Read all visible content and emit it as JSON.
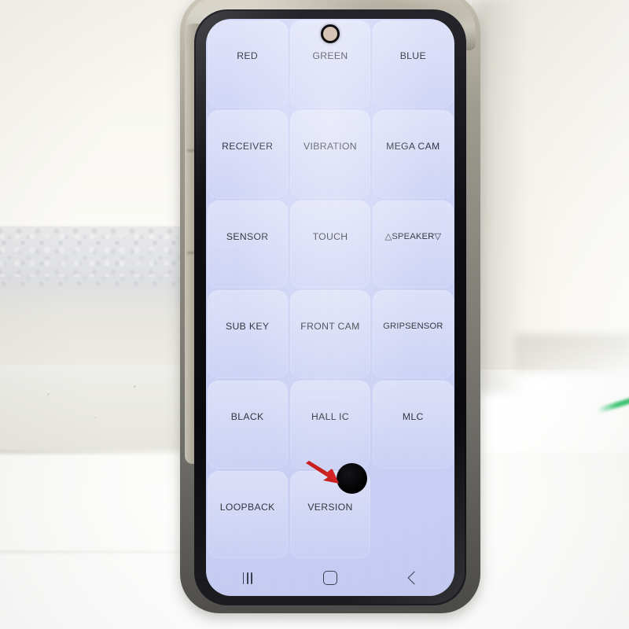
{
  "scene": {
    "description": "Smartphone LCD test mode grid displayed on a worn Samsung-style phone held on white styrofoam",
    "background_objects": [
      "styrofoam-block",
      "white-table",
      "green-streak"
    ]
  },
  "phone": {
    "frame_color": "#8e8b82",
    "bezel_color": "#0d0d10",
    "screen_color": "#cdd2f5",
    "camera": {
      "name": "punch-hole-camera",
      "lens_color": "#d7c3b6"
    }
  },
  "screen": {
    "grid": {
      "columns": 3,
      "rows": 6,
      "cells": [
        {
          "label": "RED"
        },
        {
          "label": "GREEN"
        },
        {
          "label": "BLUE"
        },
        {
          "label": "RECEIVER"
        },
        {
          "label": "VIBRATION"
        },
        {
          "label": "MEGA CAM"
        },
        {
          "label": "SENSOR"
        },
        {
          "label": "TOUCH"
        },
        {
          "label": "△SPEAKER▽"
        },
        {
          "label": "SUB KEY"
        },
        {
          "label": "FRONT CAM"
        },
        {
          "label": "GRIPSENSOR"
        },
        {
          "label": "BLACK"
        },
        {
          "label": "HALL IC"
        },
        {
          "label": "MLC"
        },
        {
          "label": "LOOPBACK"
        },
        {
          "label": "VERSION"
        },
        {
          "label": ""
        }
      ]
    },
    "annotation": {
      "defect_dot": {
        "name": "black-defect-spot",
        "color": "#000000"
      },
      "arrow": {
        "name": "red-pointer-arrow",
        "color": "#c81f1f"
      }
    },
    "navbar": {
      "recents_label": "recents",
      "home_label": "home",
      "back_label": "back"
    }
  }
}
